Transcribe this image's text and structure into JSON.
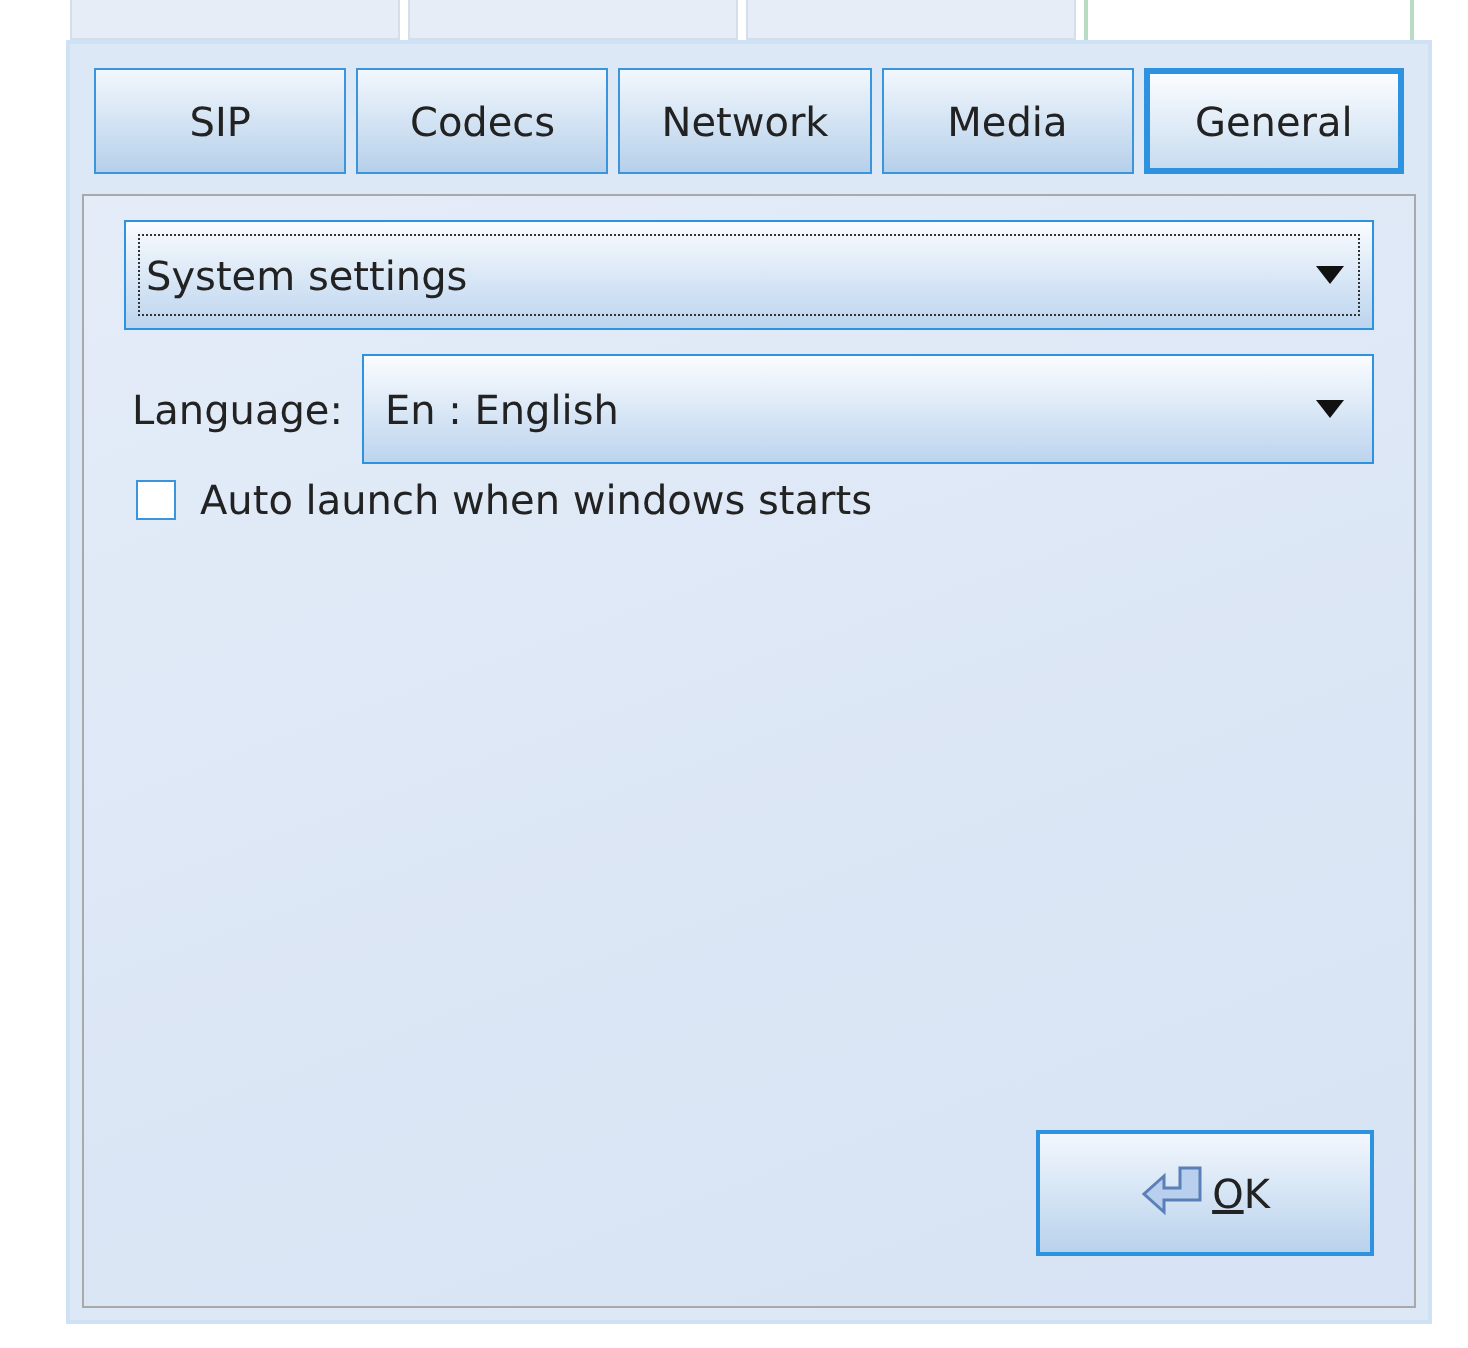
{
  "outer_tabs": [
    {
      "selected": false
    },
    {
      "selected": false
    },
    {
      "selected": false
    },
    {
      "selected": true
    }
  ],
  "tabs": [
    {
      "label": "SIP",
      "selected": false
    },
    {
      "label": "Codecs",
      "selected": false
    },
    {
      "label": "Network",
      "selected": false
    },
    {
      "label": "Media",
      "selected": false
    },
    {
      "label": "General",
      "selected": true
    }
  ],
  "settings_dropdown": {
    "value": "System settings"
  },
  "language": {
    "label": "Language:",
    "value": "En : English"
  },
  "auto_launch": {
    "label": "Auto launch when windows starts",
    "checked": false
  },
  "ok_button": {
    "label": "OK"
  }
}
